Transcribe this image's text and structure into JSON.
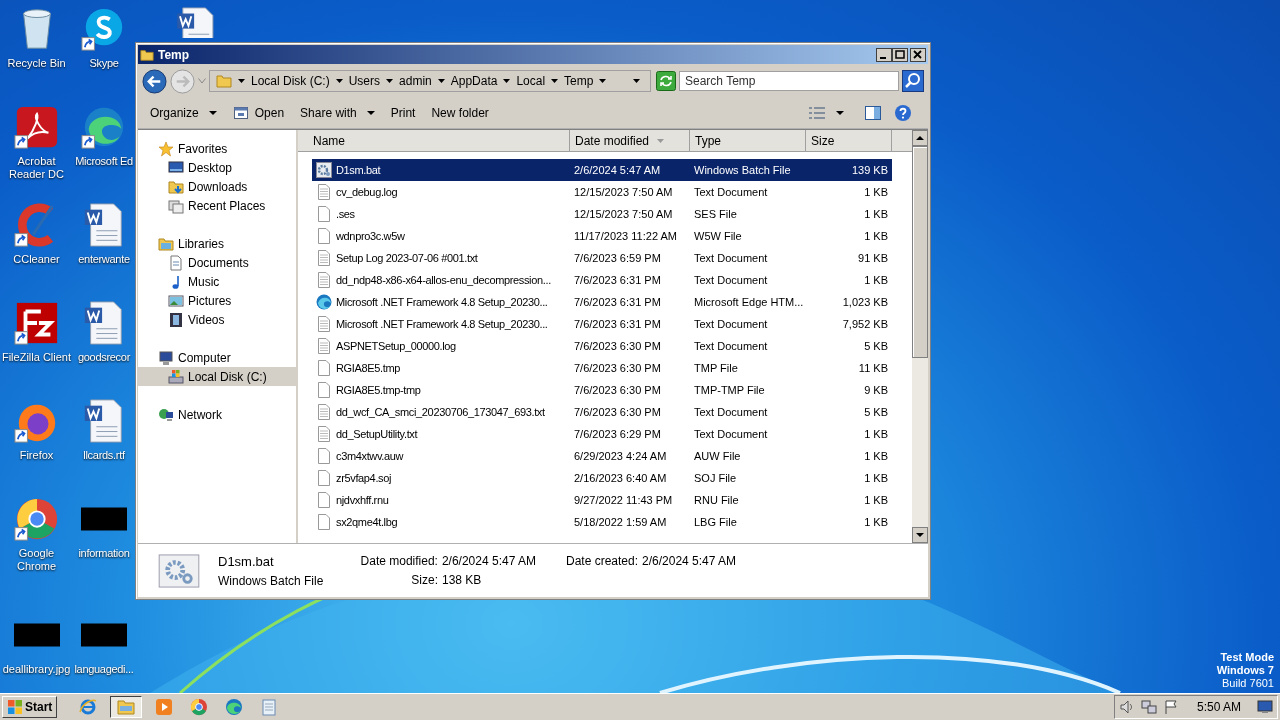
{
  "desktop": {
    "columns": [
      [
        {
          "kind": "recycle",
          "label": "Recycle Bin",
          "shortcut": false
        },
        {
          "kind": "acrobat",
          "label": "Acrobat Reader DC",
          "shortcut": true
        },
        {
          "kind": "ccleaner",
          "label": "CCleaner",
          "shortcut": true
        },
        {
          "kind": "filezilla",
          "label": "FileZilla Client",
          "shortcut": true
        },
        {
          "kind": "firefox",
          "label": "Firefox",
          "shortcut": true
        },
        {
          "kind": "chrome",
          "label": "Google Chrome",
          "shortcut": true
        },
        {
          "kind": "redacted",
          "label": "deallibrary.jpg",
          "shortcut": false
        }
      ],
      [
        {
          "kind": "skype",
          "label": "Skype",
          "shortcut": true
        },
        {
          "kind": "edge",
          "label": "Microsoft Ed",
          "shortcut": true
        },
        {
          "kind": "word",
          "label": "enterwante",
          "shortcut": false
        },
        {
          "kind": "word",
          "label": "goodsrecor",
          "shortcut": false
        },
        {
          "kind": "word",
          "label": "llcards.rtf",
          "shortcut": false
        },
        {
          "kind": "redacted",
          "label": "information",
          "shortcut": false
        },
        {
          "kind": "redacted",
          "label": "languagedi...",
          "shortcut": false
        }
      ],
      [
        {
          "kind": "word",
          "shortcut": false
        }
      ]
    ],
    "os_notice": [
      "Test Mode",
      "Windows 7",
      "Build 7601"
    ]
  },
  "window": {
    "title": "Temp",
    "breadcrumb": [
      "Local Disk (C:)",
      "Users",
      "admin",
      "AppData",
      "Local",
      "Temp"
    ],
    "search": {
      "placeholder": "Search Temp"
    },
    "toolbar": [
      {
        "label": "Organize",
        "dropdown": true
      },
      {
        "label": "Open",
        "dropdown": false
      },
      {
        "label": "Share with",
        "dropdown": true
      },
      {
        "label": "Print",
        "dropdown": false
      },
      {
        "label": "New folder",
        "dropdown": false
      }
    ],
    "nav": [
      {
        "label": "Favorites",
        "selected": false,
        "children": [
          {
            "label": "Desktop",
            "selected": false
          },
          {
            "label": "Downloads",
            "selected": false
          },
          {
            "label": "Recent Places",
            "selected": false
          }
        ]
      },
      {
        "label": "Libraries",
        "selected": false,
        "children": [
          {
            "label": "Documents",
            "selected": false
          },
          {
            "label": "Music",
            "selected": false
          },
          {
            "label": "Pictures",
            "selected": false
          },
          {
            "label": "Videos",
            "selected": false
          }
        ]
      },
      {
        "label": "Computer",
        "selected": false,
        "children": [
          {
            "label": "Local Disk (C:)",
            "selected": true
          }
        ]
      },
      {
        "label": "Network",
        "selected": false
      }
    ],
    "columns": [
      {
        "label": "Name",
        "sorted": false
      },
      {
        "label": "Date modified",
        "sorted": true
      },
      {
        "label": "Type",
        "sorted": false
      },
      {
        "label": "Size",
        "sorted": false
      }
    ],
    "rows": [
      {
        "kind": "bat",
        "name": "D1sm.bat",
        "date": "2/6/2024 5:47 AM",
        "type": "Windows Batch File",
        "size": "139 KB",
        "selected": true
      },
      {
        "kind": "text",
        "name": "cv_debug.log",
        "date": "12/15/2023 7:50 AM",
        "type": "Text Document",
        "size": "1 KB",
        "selected": false
      },
      {
        "kind": "blank",
        "name": ".ses",
        "date": "12/15/2023 7:50 AM",
        "type": "SES File",
        "size": "1 KB",
        "selected": false
      },
      {
        "kind": "blank",
        "name": "wdnpro3c.w5w",
        "date": "11/17/2023 11:22 AM",
        "type": "W5W File",
        "size": "1 KB",
        "selected": false
      },
      {
        "kind": "text",
        "name": "Setup Log 2023-07-06 #001.txt",
        "date": "7/6/2023 6:59 PM",
        "type": "Text Document",
        "size": "91 KB",
        "selected": false
      },
      {
        "kind": "text",
        "name": "dd_ndp48-x86-x64-allos-enu_decompression...",
        "date": "7/6/2023 6:31 PM",
        "type": "Text Document",
        "size": "1 KB",
        "selected": false
      },
      {
        "kind": "edge",
        "name": "Microsoft .NET Framework 4.8 Setup_20230...",
        "date": "7/6/2023 6:31 PM",
        "type": "Microsoft Edge HTM...",
        "size": "1,023 KB",
        "selected": false
      },
      {
        "kind": "text",
        "name": "Microsoft .NET Framework 4.8 Setup_20230...",
        "date": "7/6/2023 6:31 PM",
        "type": "Text Document",
        "size": "7,952 KB",
        "selected": false
      },
      {
        "kind": "text",
        "name": "ASPNETSetup_00000.log",
        "date": "7/6/2023 6:30 PM",
        "type": "Text Document",
        "size": "5 KB",
        "selected": false
      },
      {
        "kind": "blank",
        "name": "RGIA8E5.tmp",
        "date": "7/6/2023 6:30 PM",
        "type": "TMP File",
        "size": "11 KB",
        "selected": false
      },
      {
        "kind": "blank",
        "name": "RGIA8E5.tmp-tmp",
        "date": "7/6/2023 6:30 PM",
        "type": "TMP-TMP File",
        "size": "9 KB",
        "selected": false
      },
      {
        "kind": "text",
        "name": "dd_wcf_CA_smci_20230706_173047_693.txt",
        "date": "7/6/2023 6:30 PM",
        "type": "Text Document",
        "size": "5 KB",
        "selected": false
      },
      {
        "kind": "text",
        "name": "dd_SetupUtility.txt",
        "date": "7/6/2023 6:29 PM",
        "type": "Text Document",
        "size": "1 KB",
        "selected": false
      },
      {
        "kind": "blank",
        "name": "c3m4xtwv.auw",
        "date": "6/29/2023 4:24 AM",
        "type": "AUW File",
        "size": "1 KB",
        "selected": false
      },
      {
        "kind": "blank",
        "name": "zr5vfap4.soj",
        "date": "2/16/2023 6:40 AM",
        "type": "SOJ File",
        "size": "1 KB",
        "selected": false
      },
      {
        "kind": "blank",
        "name": "njdvxhff.rnu",
        "date": "9/27/2022 11:43 PM",
        "type": "RNU File",
        "size": "1 KB",
        "selected": false
      },
      {
        "kind": "blank",
        "name": "sx2qme4t.lbg",
        "date": "5/18/2022 1:59 AM",
        "type": "LBG File",
        "size": "1 KB",
        "selected": false
      }
    ],
    "details": {
      "name": "D1sm.bat",
      "type": "Windows Batch File",
      "fields": [
        {
          "label": "Date modified:",
          "value": "2/6/2024 5:47 AM"
        },
        {
          "label": "Size:",
          "value": "138 KB"
        },
        {
          "label": "Date created:",
          "value": "2/6/2024 5:47 AM"
        }
      ]
    }
  },
  "taskbar": {
    "start": "Start",
    "apps": [
      {
        "kind": "ie",
        "active": false
      },
      {
        "kind": "explorer",
        "active": true
      },
      {
        "kind": "media",
        "active": false
      },
      {
        "kind": "chrome",
        "active": false
      },
      {
        "kind": "edge",
        "active": false
      },
      {
        "kind": "notepad",
        "active": false
      }
    ],
    "clock": "5:50 AM"
  }
}
